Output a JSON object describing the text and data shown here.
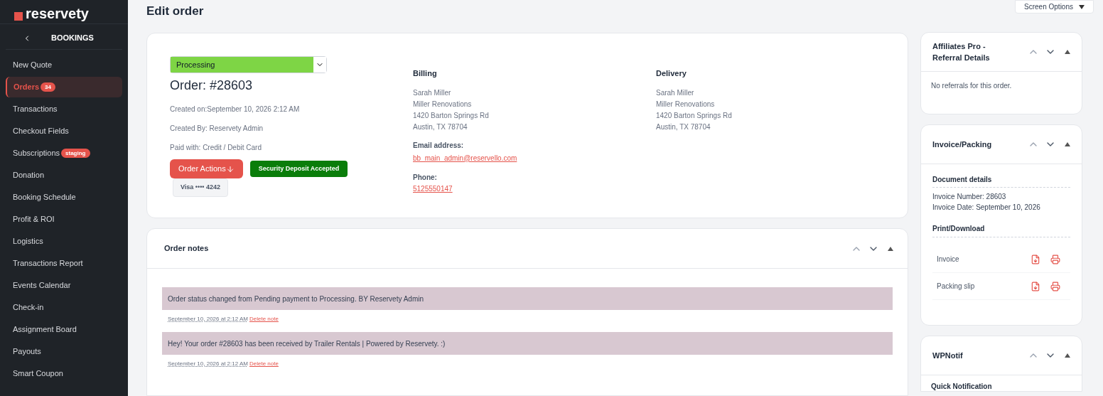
{
  "sidebar": {
    "logo": "reservety",
    "section": "BOOKINGS",
    "items": [
      {
        "label": "New Quote",
        "selected": false
      },
      {
        "label": "Orders",
        "selected": true,
        "badge": "34"
      },
      {
        "label": "Transactions",
        "selected": false
      },
      {
        "label": "Checkout Fields",
        "selected": false
      },
      {
        "label": "Subscriptions",
        "selected": false,
        "badge": "staging"
      },
      {
        "label": "Donation",
        "selected": false
      },
      {
        "label": "Booking Schedule",
        "selected": false
      },
      {
        "label": "Profit & ROI",
        "selected": false
      },
      {
        "label": "Logistics",
        "selected": false
      },
      {
        "label": "Transactions Report",
        "selected": false
      },
      {
        "label": "Events Calendar",
        "selected": false
      },
      {
        "label": "Check-in",
        "selected": false
      },
      {
        "label": "Assignment Board",
        "selected": false
      },
      {
        "label": "Payouts",
        "selected": false
      },
      {
        "label": "Smart Coupon",
        "selected": false
      }
    ]
  },
  "page_title": "Edit order",
  "screen_options": "Screen Options",
  "order": {
    "status": "Processing",
    "title": "Order: #28603",
    "meta": [
      "Created on:September 10, 2026 2:12 AM",
      "Created By: Reservety Admin",
      "Paid with: Credit / Debit Card"
    ],
    "actions_button": "Order Actions",
    "deposit_badge": "Security Deposit Accepted",
    "card": "Visa •••• 4242",
    "billing": {
      "heading": "Billing",
      "address": [
        "Sarah Miller",
        "Miller Renovations",
        "1420 Barton Springs Rd",
        "Austin, TX 78704"
      ],
      "email_label": "Email address:",
      "email": "bb_main_admin@reservello.com",
      "phone_label": "Phone:",
      "phone": "5125550147"
    },
    "delivery": {
      "heading": "Delivery",
      "address": [
        "Sarah Miller",
        "Miller Renovations",
        "1420 Barton Springs Rd",
        "Austin, TX 78704"
      ]
    }
  },
  "order_notes": {
    "title": "Order notes",
    "notes": [
      {
        "text": "Order status changed from Pending payment to Processing. BY Reservety Admin",
        "date": "September 10, 2026 at 2:12 AM",
        "delete": "Delete note"
      },
      {
        "text": "Hey! Your order #28603 has been received by Trailer Rentals | Powered by Reservety. :)",
        "date": "September 10, 2026 at 2:12 AM",
        "delete": "Delete note"
      }
    ]
  },
  "affiliates": {
    "title": "Affiliates Pro - Referral Details",
    "body": "No referrals for this order."
  },
  "invoice": {
    "title": "Invoice/Packing",
    "details_heading": "Document details",
    "details": [
      "Invoice Number: 28603",
      "Invoice Date: September 10, 2026"
    ],
    "print_heading": "Print/Download",
    "documents": [
      "Invoice",
      "Packing slip"
    ]
  },
  "wpnotif": {
    "title": "WPNotif",
    "subheading": "Quick Notification"
  }
}
